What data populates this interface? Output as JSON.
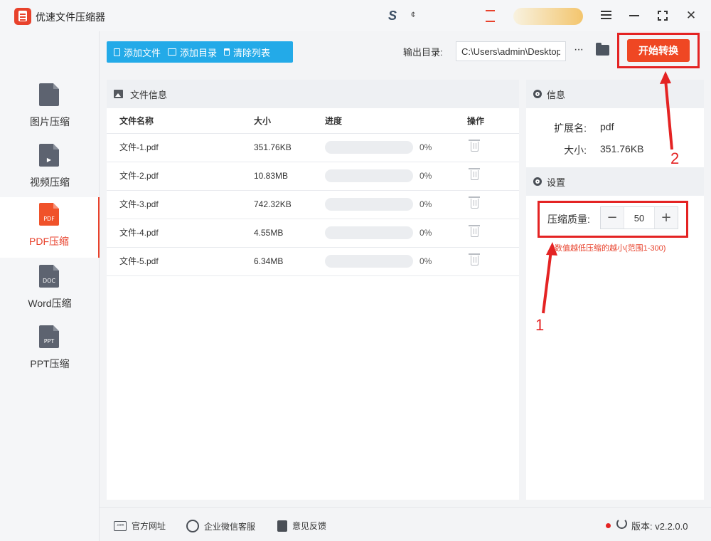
{
  "app": {
    "title": "优速文件压缩器"
  },
  "titlebar": {
    "decor_s": "S",
    "decor_s2": "¢"
  },
  "sidebar": {
    "items": [
      {
        "label": "图片压缩",
        "icon": "image-file-icon",
        "icon_text": ""
      },
      {
        "label": "视频压缩",
        "icon": "video-file-icon",
        "icon_text": "▶"
      },
      {
        "label": "PDF压缩",
        "icon": "pdf-file-icon",
        "icon_text": "PDF",
        "active": true
      },
      {
        "label": "Word压缩",
        "icon": "doc-file-icon",
        "icon_text": "DOC"
      },
      {
        "label": "PPT压缩",
        "icon": "ppt-file-icon",
        "icon_text": "PPT"
      }
    ]
  },
  "toolbar": {
    "add_file": "添加文件",
    "add_folder": "添加目录",
    "clear_list": "清除列表",
    "output_label": "输出目录:",
    "output_path": "C:\\Users\\admin\\Desktop",
    "more": "···",
    "start": "开始转换"
  },
  "file_panel": {
    "title": "文件信息",
    "columns": {
      "name": "文件名称",
      "size": "大小",
      "progress": "进度",
      "action": "操作"
    },
    "rows": [
      {
        "name": "文件-1.pdf",
        "size": "351.76KB",
        "progress": 0,
        "progress_text": "0%"
      },
      {
        "name": "文件-2.pdf",
        "size": "10.83MB",
        "progress": 0,
        "progress_text": "0%"
      },
      {
        "name": "文件-3.pdf",
        "size": "742.32KB",
        "progress": 0,
        "progress_text": "0%"
      },
      {
        "name": "文件-4.pdf",
        "size": "4.55MB",
        "progress": 0,
        "progress_text": "0%"
      },
      {
        "name": "文件-5.pdf",
        "size": "6.34MB",
        "progress": 0,
        "progress_text": "0%"
      }
    ]
  },
  "info_panel": {
    "title": "信息",
    "ext_label": "扩展名:",
    "ext_value": "pdf",
    "size_label": "大小:",
    "size_value": "351.76KB"
  },
  "settings_panel": {
    "title": "设置",
    "quality_label": "压缩质量:",
    "quality_value": "50",
    "minus": "−",
    "plus": "+",
    "hint": "数值越低压缩的越小(范围1-300)"
  },
  "annotations": {
    "num1": "1",
    "num2": "2",
    "color": "#e42323"
  },
  "footer": {
    "website": "官方网址",
    "wechat": "企业微信客服",
    "feedback": "意见反馈",
    "version": "版本: v2.2.0.0",
    "web_icon_text": ".com"
  },
  "colors": {
    "accent": "#ef4723",
    "blue": "#23aae8"
  }
}
